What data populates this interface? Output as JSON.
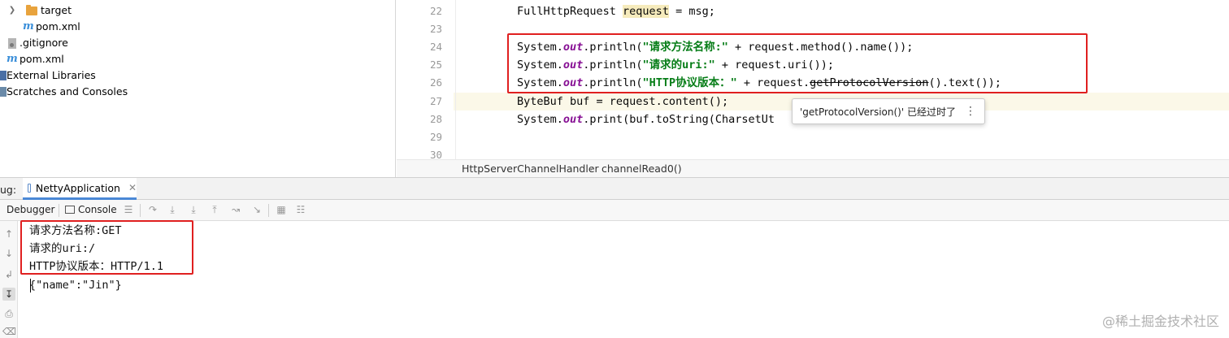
{
  "project_tree": {
    "items": [
      {
        "label": "target",
        "icon": "folder-icon"
      },
      {
        "label": "pom.xml",
        "icon": "maven-icon"
      },
      {
        "label": ".gitignore",
        "icon": "file-icon"
      },
      {
        "label": "pom.xml",
        "icon": "maven-icon"
      },
      {
        "label": "External Libraries",
        "icon": "library-icon"
      },
      {
        "label": "Scratches and Consoles",
        "icon": "scratches-icon"
      }
    ]
  },
  "editor": {
    "line_numbers": [
      "22",
      "23",
      "24",
      "25",
      "26",
      "27",
      "28",
      "29",
      "30"
    ],
    "lines": {
      "l22": {
        "a": "FullHttpRequest ",
        "b": "request",
        "c": " = msg;"
      },
      "l24": {
        "a": "System.",
        "b": "out",
        "c": ".println(",
        "d": "\"请求方法名称:\"",
        "e": " + request.method().name());"
      },
      "l25": {
        "a": "System.",
        "b": "out",
        "c": ".println(",
        "d": "\"请求的uri:\"",
        "e": " + request.uri());"
      },
      "l26": {
        "a": "System.",
        "b": "out",
        "c": ".println(",
        "d": "\"HTTP协议版本：\"",
        "e": " + request.",
        "f": "getProtocolVersion",
        "g": "().text());"
      },
      "l27": {
        "a": "ByteBuf buf = request.content();"
      },
      "l28": {
        "a": "System.",
        "b": "out",
        "c": ".print(buf.toString(CharsetUt"
      }
    },
    "tooltip": "'getProtocolVersion()' 已经过时了",
    "breadcrumb": [
      "HttpServerChannelHandler",
      "channelRead0()"
    ]
  },
  "debug_panel": {
    "label": "ug:",
    "run_tab": "NettyApplication",
    "toolbar": {
      "debugger": "Debugger",
      "console": "Console"
    }
  },
  "console": {
    "lines": [
      "请求方法名称:GET",
      "请求的uri:/",
      "HTTP协议版本：HTTP/1.1",
      "{\"name\":\"Jin\"}"
    ]
  },
  "watermark": "@稀土掘金技术社区",
  "colors": {
    "highlight_box": "#e02020",
    "string": "#067d17",
    "static_field": "#871094",
    "tab_accent": "#4a88d6"
  }
}
